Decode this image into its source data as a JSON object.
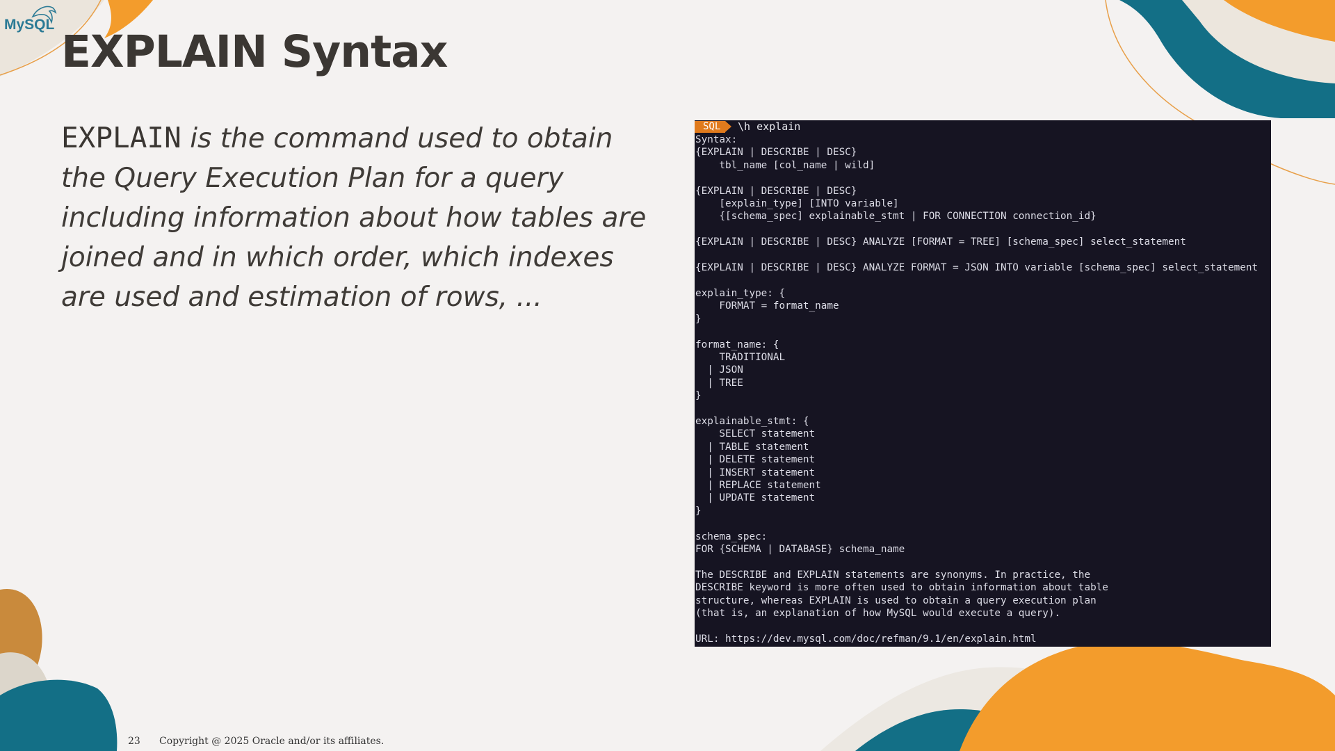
{
  "brand": {
    "logo_text": "MySQL"
  },
  "slide": {
    "title": "EXPLAIN Syntax",
    "lead_keyword": "EXPLAIN",
    "lead_text": " is the command used to obtain the Query Execution Plan for a query including information about how tables are joined and in which order, which indexes are used and estimation of rows, ..."
  },
  "terminal": {
    "prompt_label": "SQL",
    "command": "\\h explain",
    "output": "Syntax:\n{EXPLAIN | DESCRIBE | DESC}\n    tbl_name [col_name | wild]\n\n{EXPLAIN | DESCRIBE | DESC}\n    [explain_type] [INTO variable]\n    {[schema_spec] explainable_stmt | FOR CONNECTION connection_id}\n\n{EXPLAIN | DESCRIBE | DESC} ANALYZE [FORMAT = TREE] [schema_spec] select_statement\n\n{EXPLAIN | DESCRIBE | DESC} ANALYZE FORMAT = JSON INTO variable [schema_spec] select_statement\n\nexplain_type: {\n    FORMAT = format_name\n}\n\nformat_name: {\n    TRADITIONAL\n  | JSON\n  | TREE\n}\n\nexplainable_stmt: {\n    SELECT statement\n  | TABLE statement\n  | DELETE statement\n  | INSERT statement\n  | REPLACE statement\n  | UPDATE statement\n}\n\nschema_spec:\nFOR {SCHEMA | DATABASE} schema_name\n\nThe DESCRIBE and EXPLAIN statements are synonyms. In practice, the\nDESCRIBE keyword is more often used to obtain information about table\nstructure, whereas EXPLAIN is used to obtain a query execution plan\n(that is, an explanation of how MySQL would execute a query).\n\nURL: https://dev.mysql.com/doc/refman/9.1/en/explain.html"
  },
  "footer": {
    "page_number": "23",
    "copyright": "Copyright @ 2025 Oracle and/or its affiliates."
  },
  "colors": {
    "background": "#f4f2f1",
    "title": "#3b3733",
    "terminal_bg": "#161422",
    "accent_orange": "#f39c2c",
    "accent_teal": "#136f86",
    "logo_blue": "#2b7a95"
  }
}
